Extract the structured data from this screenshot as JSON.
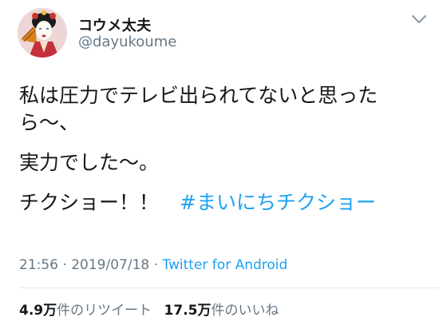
{
  "user": {
    "display_name": "コウメ太夫",
    "handle": "@dayukoume",
    "avatar_icon": "profile-photo-icon"
  },
  "menu": {
    "icon": "chevron-down-icon"
  },
  "tweet": {
    "line1": "私は圧力でテレビ出られてないと思った",
    "line2": "ら〜、",
    "line3": "実力でした〜。",
    "line4": "チクショー！！",
    "hashtag": "#まいにちチクショー"
  },
  "meta": {
    "time": "21:56",
    "separator1": " · ",
    "date": "2019/07/18",
    "separator2": " · ",
    "source": "Twitter for Android"
  },
  "stats": {
    "retweet_count": "4.9万",
    "retweet_label": "件のリツイート",
    "like_count": "17.5万",
    "like_label": "件のいいね"
  },
  "colors": {
    "link": "#1da1f2",
    "secondary_text": "#657786",
    "primary_text": "#14171a",
    "divider": "#e1e8ed"
  }
}
